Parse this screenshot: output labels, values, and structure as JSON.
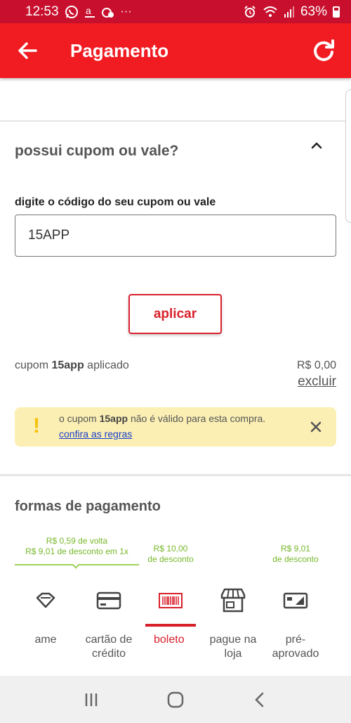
{
  "status_bar": {
    "time": "12:53",
    "battery_text": "63%",
    "more": "···"
  },
  "app_bar": {
    "title": "Pagamento"
  },
  "coupon": {
    "question": "possui cupom ou vale?",
    "field_label": "digite o código do seu cupom ou vale",
    "code_value": "15APP",
    "apply_label": "aplicar",
    "applied_prefix": "cupom ",
    "applied_code": "15app",
    "applied_suffix": " aplicado",
    "applied_value": "R$ 0,00",
    "remove_label": "excluir"
  },
  "warning": {
    "prefix": "o cupom ",
    "code": "15app",
    "suffix": " não é válido para esta compra.",
    "rules_link": "confira as regras"
  },
  "payment": {
    "section_title": "formas de pagamento",
    "promos": [
      {
        "line1": "R$ 0,59  de volta",
        "line2": "R$ 9,01 de desconto em 1x"
      },
      {
        "line1": "R$ 10,00",
        "line2": "de desconto"
      },
      {
        "line1": "R$ 9,01",
        "line2": "de desconto"
      }
    ],
    "methods": [
      {
        "label": "ame",
        "icon": "ame-icon"
      },
      {
        "label": "cartão de crédito",
        "icon": "credit-card-icon"
      },
      {
        "label": "boleto",
        "icon": "barcode-icon",
        "selected": true
      },
      {
        "label": "pague na loja",
        "icon": "store-icon"
      },
      {
        "label": "pré-aprovado",
        "icon": "pre-approved-card-icon"
      }
    ]
  },
  "colors": {
    "status_bar": "#c8102e",
    "app_bar": "#f01c22",
    "accent_red": "#d9212c",
    "promo_green": "#76b82a",
    "warning_bg": "#fbefb4",
    "link_blue": "#1a3ec9"
  }
}
